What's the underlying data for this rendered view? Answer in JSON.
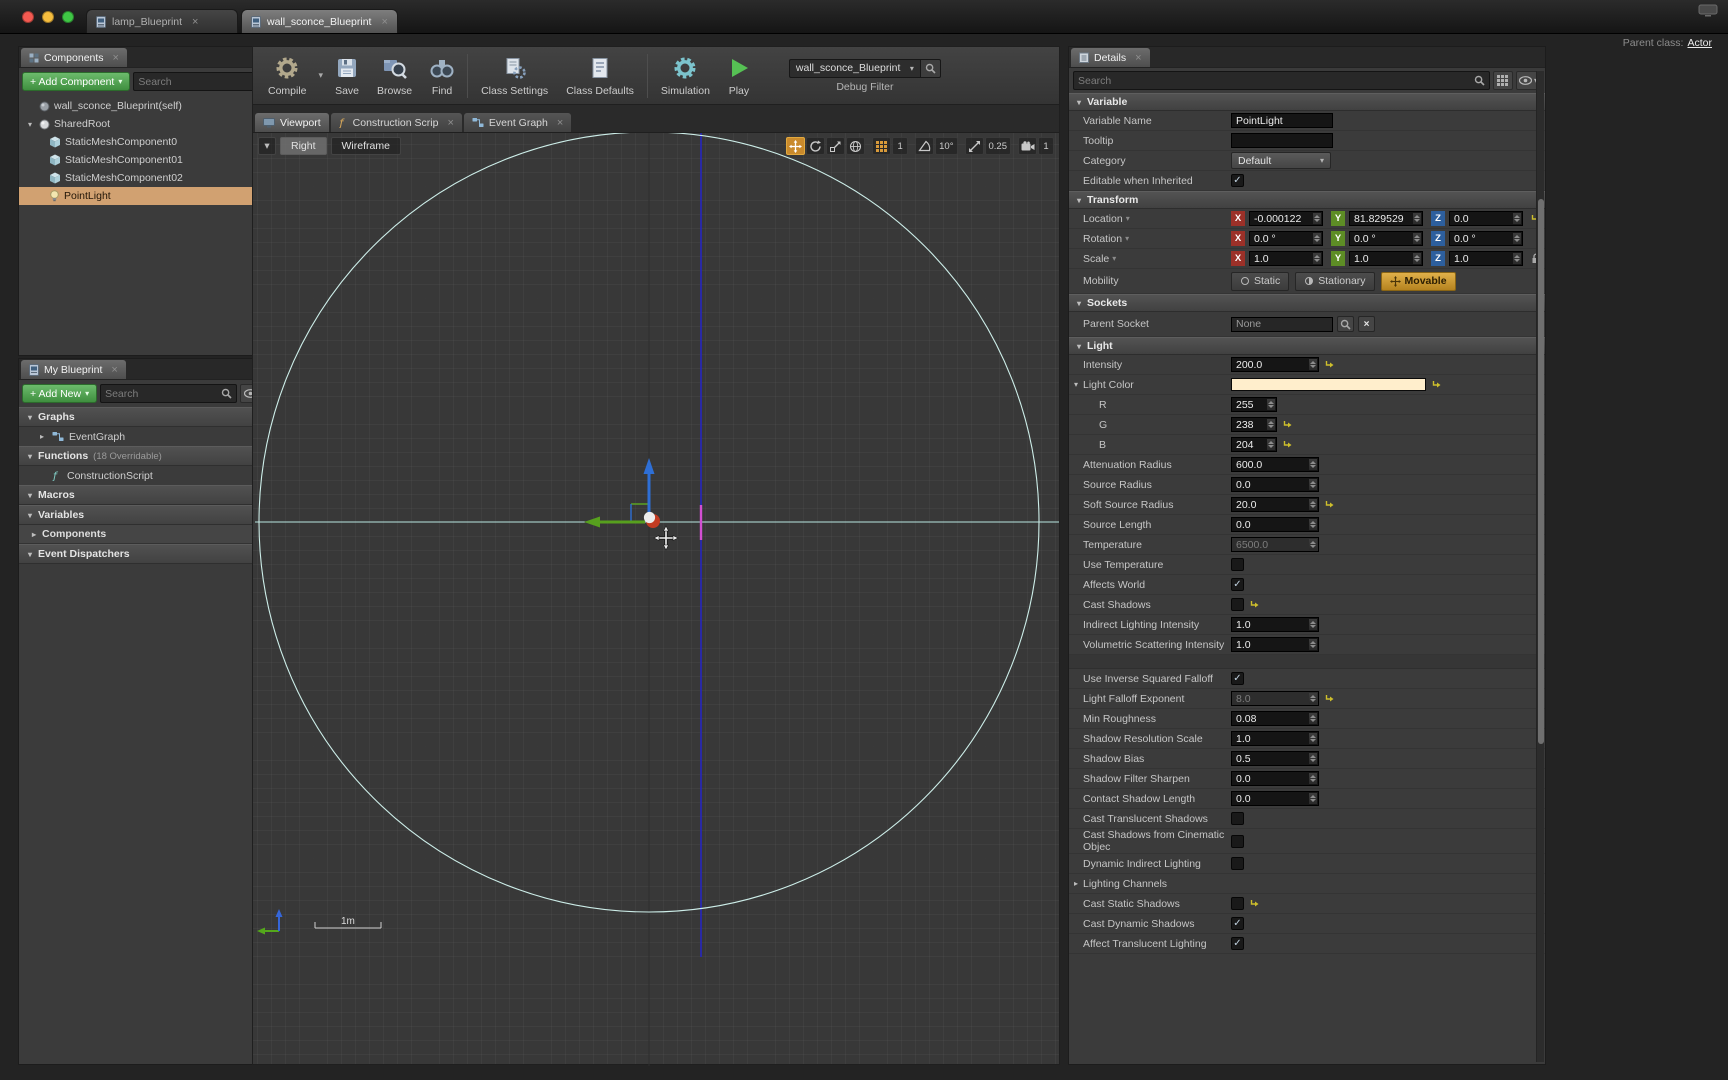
{
  "glyphs": {
    "close": "×",
    "caret_down": "▾",
    "caret_right": "▸",
    "plus": "+",
    "check": "✓"
  },
  "window": {
    "tabs": [
      {
        "label": "lamp_Blueprint"
      },
      {
        "label": "wall_sconce_Blueprint"
      }
    ],
    "parent_class_label": "Parent class:",
    "parent_class_value": "Actor"
  },
  "components": {
    "tab": "Components",
    "add_button": "+ Add Component",
    "search_placeholder": "Search",
    "tree": [
      {
        "label": "wall_sconce_Blueprint(self)",
        "icon": "blueprint-self-icon",
        "depth": 0
      },
      {
        "label": "SharedRoot",
        "icon": "scene-root-icon",
        "depth": 0,
        "expander": "▾"
      },
      {
        "label": "StaticMeshComponent0",
        "icon": "static-mesh-icon",
        "depth": 1
      },
      {
        "label": "StaticMeshComponent01",
        "icon": "static-mesh-icon",
        "depth": 1
      },
      {
        "label": "StaticMeshComponent02",
        "icon": "static-mesh-icon",
        "depth": 1
      },
      {
        "label": "PointLight",
        "icon": "point-light-icon",
        "depth": 1,
        "selected": true
      }
    ]
  },
  "my_blueprint": {
    "tab": "My Blueprint",
    "add_button": "+ Add New",
    "search_placeholder": "Search",
    "rows": [
      {
        "kind": "section",
        "label": "Graphs",
        "expander": "▾",
        "add": true
      },
      {
        "kind": "item",
        "label": "EventGraph",
        "icon": "event-graph-icon",
        "expander": "▸"
      },
      {
        "kind": "section",
        "label": "Functions",
        "note": "(18 Overridable)",
        "expander": "▾",
        "add": true
      },
      {
        "kind": "item",
        "label": "ConstructionScript",
        "icon": "construction-script-icon"
      },
      {
        "kind": "section",
        "label": "Macros",
        "expander": "▾",
        "add": true
      },
      {
        "kind": "section",
        "label": "Variables",
        "expander": "▾",
        "add": true
      },
      {
        "kind": "subsection",
        "label": "Components",
        "expander": "▸"
      },
      {
        "kind": "section",
        "label": "Event Dispatchers",
        "expander": "▾",
        "add": true
      }
    ]
  },
  "toolbar": {
    "buttons": [
      {
        "label": "Compile",
        "icon": "compile-icon",
        "dropdown": true
      },
      {
        "label": "Save",
        "icon": "save-icon"
      },
      {
        "label": "Browse",
        "icon": "browse-icon"
      },
      {
        "label": "Find",
        "icon": "find-icon"
      },
      {
        "label": "Class Settings",
        "icon": "class-settings-icon",
        "sep_before": true
      },
      {
        "label": "Class Defaults",
        "icon": "class-defaults-icon"
      },
      {
        "label": "Simulation",
        "icon": "simulation-icon",
        "sep_before": true
      },
      {
        "label": "Play",
        "icon": "play-icon"
      }
    ],
    "debug_filter_value": "wall_sconce_Blueprint",
    "debug_filter_label": "Debug Filter"
  },
  "viewport": {
    "tabs": [
      {
        "label": "Viewport"
      },
      {
        "label": "Construction Scrip"
      },
      {
        "label": "Event Graph"
      }
    ],
    "view_button": "Right",
    "shading_button": "Wireframe",
    "snaps": {
      "grid": "1",
      "angle": "10°",
      "scale": "0.25",
      "camera": "1"
    },
    "scale_bar": "1m"
  },
  "details": {
    "tab": "Details",
    "search_placeholder": "Search",
    "axis": {
      "x": "X",
      "y": "Y",
      "z": "Z"
    },
    "sections": {
      "variable": "Variable",
      "transform": "Transform",
      "sockets": "Sockets",
      "light": "Light"
    },
    "variable_rows": [
      {
        "label": "Variable Name",
        "type": "text",
        "value": "PointLight"
      },
      {
        "label": "Tooltip",
        "type": "text",
        "value": ""
      },
      {
        "label": "Category",
        "type": "dropdown",
        "value": "Default"
      },
      {
        "label": "Editable when Inherited",
        "type": "check",
        "checked": true
      }
    ],
    "transform": {
      "location_label": "Location",
      "location": {
        "x": "-0.000122",
        "y": "81.829529",
        "z": "0.0"
      },
      "rotation_label": "Rotation",
      "rotation": {
        "x": "0.0 °",
        "y": "0.0 °",
        "z": "0.0 °"
      },
      "scale_label": "Scale",
      "scale": {
        "x": "1.0",
        "y": "1.0",
        "z": "1.0"
      },
      "mobility_label": "Mobility",
      "mobility_options": [
        {
          "label": "Static"
        },
        {
          "label": "Stationary"
        },
        {
          "label": "Movable",
          "selected": true
        }
      ]
    },
    "sockets": {
      "parent_socket_label": "Parent Socket",
      "parent_socket_value": "None"
    },
    "light_rows": [
      {
        "label": "Intensity",
        "type": "number",
        "value": "200.0",
        "modified": true
      },
      {
        "label": "Light Color",
        "type": "color",
        "value": "#FFEECC",
        "expander": "▾",
        "modified": true
      },
      {
        "label": "R",
        "type": "number",
        "value": "255",
        "indent": true
      },
      {
        "label": "G",
        "type": "number",
        "value": "238",
        "indent": true,
        "modified": true
      },
      {
        "label": "B",
        "type": "number",
        "value": "204",
        "indent": true,
        "modified": true
      },
      {
        "label": "Attenuation Radius",
        "type": "number",
        "value": "600.0"
      },
      {
        "label": "Source Radius",
        "type": "number",
        "value": "0.0"
      },
      {
        "label": "Soft Source Radius",
        "type": "number",
        "value": "20.0",
        "modified": true
      },
      {
        "label": "Source Length",
        "type": "number",
        "value": "0.0"
      },
      {
        "label": "Temperature",
        "type": "number",
        "value": "6500.0",
        "disabled": true
      },
      {
        "label": "Use Temperature",
        "type": "check",
        "checked": false
      },
      {
        "label": "Affects World",
        "type": "check",
        "checked": true
      },
      {
        "label": "Cast Shadows",
        "type": "check",
        "checked": false,
        "modified": true
      },
      {
        "label": "Indirect Lighting Intensity",
        "type": "number",
        "value": "1.0"
      },
      {
        "label": "Volumetric Scattering Intensity",
        "type": "number",
        "value": "1.0"
      }
    ],
    "light_rows_advanced": [
      {
        "label": "Use Inverse Squared Falloff",
        "type": "check",
        "checked": true
      },
      {
        "label": "Light Falloff Exponent",
        "type": "number",
        "value": "8.0",
        "disabled": true,
        "modified": true
      },
      {
        "label": "Min Roughness",
        "type": "number",
        "value": "0.08"
      },
      {
        "label": "Shadow Resolution Scale",
        "type": "number",
        "value": "1.0"
      },
      {
        "label": "Shadow Bias",
        "type": "number",
        "value": "0.5"
      },
      {
        "label": "Shadow Filter Sharpen",
        "type": "number",
        "value": "0.0"
      },
      {
        "label": "Contact Shadow Length",
        "type": "number",
        "value": "0.0"
      },
      {
        "label": "Cast Translucent Shadows",
        "type": "check",
        "checked": false
      },
      {
        "label": "Cast Shadows from Cinematic Objec",
        "type": "check",
        "checked": false
      },
      {
        "label": "Dynamic Indirect Lighting",
        "type": "check",
        "checked": false
      },
      {
        "label": "Lighting Channels",
        "type": "expand",
        "expander": "▸"
      },
      {
        "label": "Cast Static Shadows",
        "type": "check",
        "checked": false,
        "modified": true
      },
      {
        "label": "Cast Dynamic Shadows",
        "type": "check",
        "checked": true
      },
      {
        "label": "Affect Translucent Lighting",
        "type": "check",
        "checked": true
      }
    ]
  }
}
